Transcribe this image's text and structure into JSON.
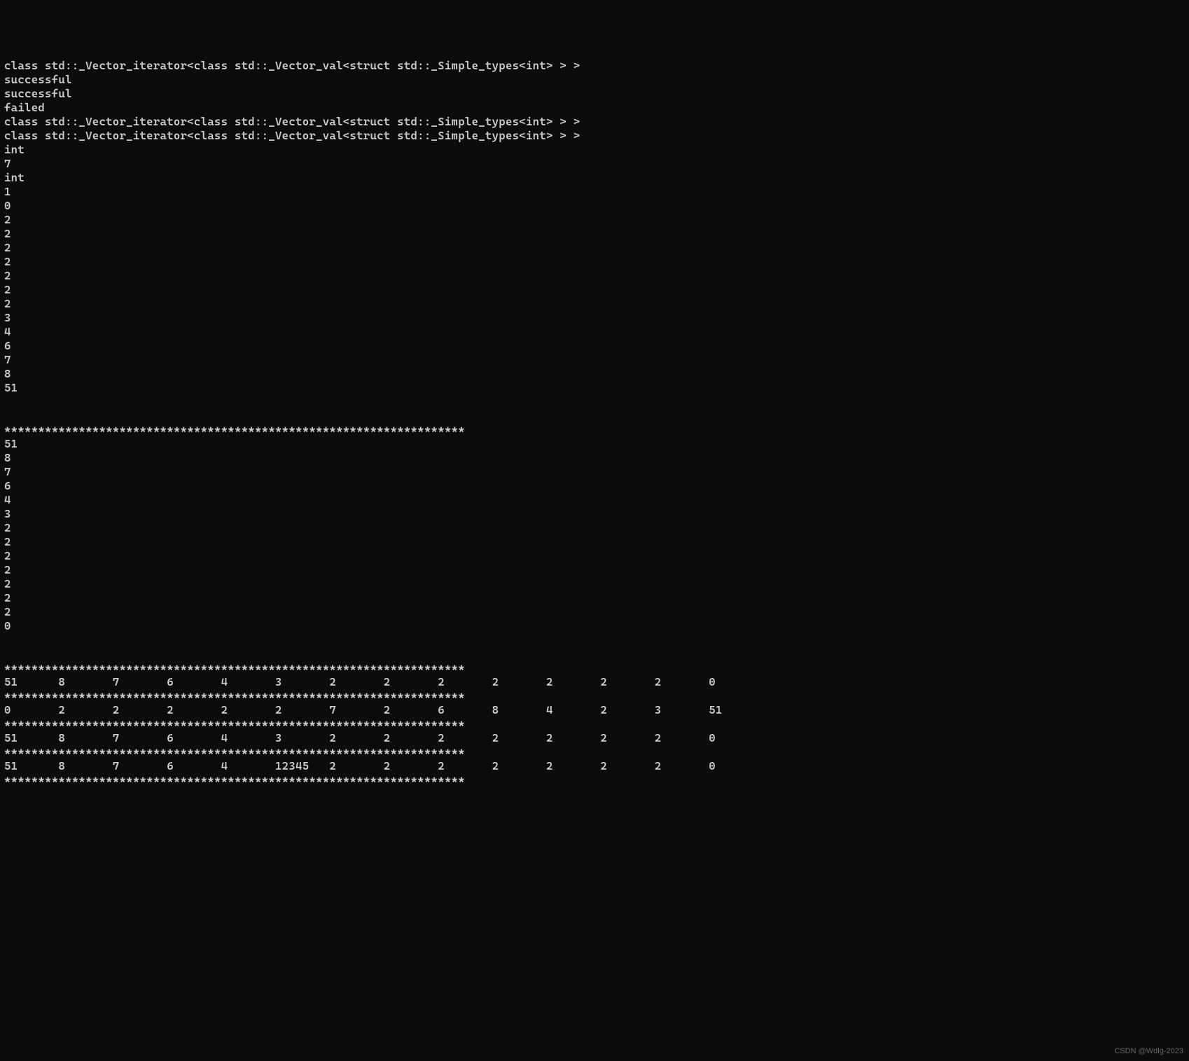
{
  "lines": [
    "class std::_Vector_iterator<class std::_Vector_val<struct std::_Simple_types<int> > >",
    "successful",
    "successful",
    "failed",
    "class std::_Vector_iterator<class std::_Vector_val<struct std::_Simple_types<int> > >",
    "class std::_Vector_iterator<class std::_Vector_val<struct std::_Simple_types<int> > >",
    "int",
    "7",
    "int",
    "1",
    "0",
    "2",
    "2",
    "2",
    "2",
    "2",
    "2",
    "2",
    "3",
    "4",
    "6",
    "7",
    "8",
    "51",
    "",
    "",
    "********************************************************************",
    "51",
    "8",
    "7",
    "6",
    "4",
    "3",
    "2",
    "2",
    "2",
    "2",
    "2",
    "2",
    "2",
    "0",
    "",
    "",
    "********************************************************************",
    "51      8       7       6       4       3       2       2       2       2       2       2       2       0",
    "********************************************************************",
    "0       2       2       2       2       2       7       2       6       8       4       2       3       51",
    "********************************************************************",
    "51      8       7       6       4       3       2       2       2       2       2       2       2       0",
    "********************************************************************",
    "51      8       7       6       4       12345   2       2       2       2       2       2       2       0",
    "********************************************************************"
  ],
  "watermark": "CSDN @Wdlg-2023"
}
